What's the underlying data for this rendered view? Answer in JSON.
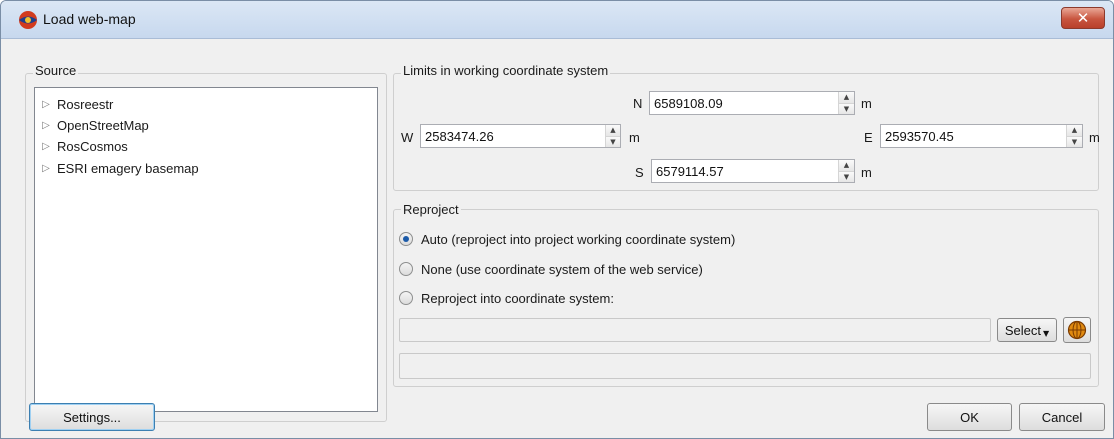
{
  "window": {
    "title": "Load web-map"
  },
  "source": {
    "title": "Source",
    "items": [
      {
        "label": "Rosreestr"
      },
      {
        "label": "OpenStreetMap"
      },
      {
        "label": "RosCosmos"
      },
      {
        "label": "ESRI emagery basemap"
      }
    ]
  },
  "limits": {
    "title": "Limits in working coordinate system",
    "north": {
      "label": "N",
      "value": "6589108.09",
      "unit": "m"
    },
    "west": {
      "label": "W",
      "value": "2583474.26",
      "unit": "m"
    },
    "east": {
      "label": "E",
      "value": "2593570.45",
      "unit": "m"
    },
    "south": {
      "label": "S",
      "value": "6579114.57",
      "unit": "m"
    }
  },
  "reproject": {
    "title": "Reproject",
    "options": [
      {
        "label": "Auto (reproject into project working coordinate system)",
        "checked": true
      },
      {
        "label": "None (use coordinate system of the web service)",
        "checked": false
      },
      {
        "label": "Reproject into coordinate system:",
        "checked": false
      }
    ],
    "coordinate_system_value": "",
    "description_value": "",
    "select_label": "Select"
  },
  "buttons": {
    "settings": "Settings...",
    "ok": "OK",
    "cancel": "Cancel"
  },
  "icons": {
    "app": "web-map-icon",
    "close": "close-icon",
    "tree_expand": "triangle-right-icon",
    "globe": "globe-icon"
  },
  "colors": {
    "titlebar": "#c7d8ee",
    "close_button": "#c8553f",
    "radio_dot": "#1b5aa8",
    "globe": "#e08a10"
  }
}
